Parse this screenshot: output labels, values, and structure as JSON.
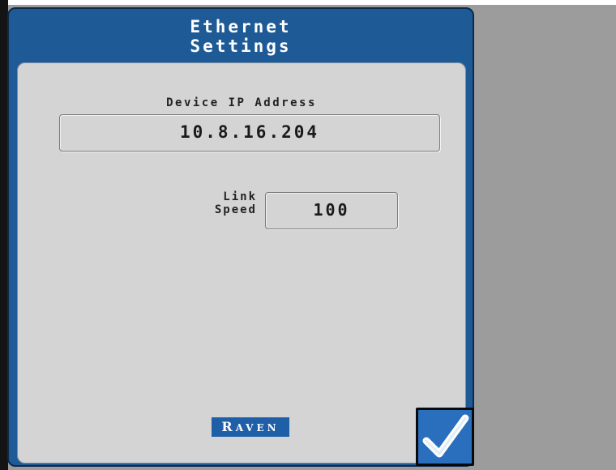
{
  "window": {
    "title_line1": "Ethernet",
    "title_line2": "Settings"
  },
  "ip": {
    "label": "Device IP Address",
    "value": "10.8.16.204"
  },
  "link_speed": {
    "label_line1": "Link",
    "label_line2": "Speed",
    "value": "100"
  },
  "logo": {
    "first_letter": "R",
    "rest": "AVEN"
  },
  "confirm": {
    "icon": "checkmark-icon"
  },
  "colors": {
    "header_blue": "#1e5a96",
    "panel_gray": "#d4d4d4",
    "confirm_blue": "#2a6fbe",
    "logo_blue": "#1f5fa8"
  }
}
